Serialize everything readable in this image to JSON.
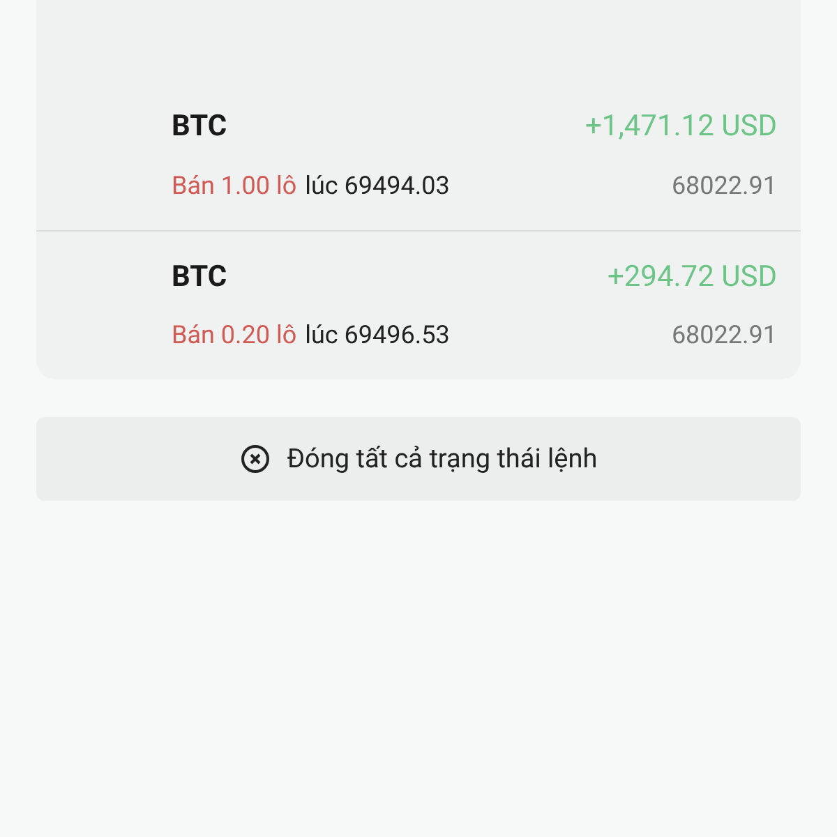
{
  "positions": [
    {
      "symbol": "BTC",
      "profit": "+1,471.12 USD",
      "order": "Bán 1.00 lô",
      "at_price": "lúc 69494.03",
      "current_price": "68022.91"
    },
    {
      "symbol": "BTC",
      "profit": "+294.72 USD",
      "order": "Bán 0.20 lô",
      "at_price": "lúc 69496.53",
      "current_price": "68022.91"
    }
  ],
  "close_all_button": {
    "label": "Đóng tất cả trạng thái lệnh"
  }
}
